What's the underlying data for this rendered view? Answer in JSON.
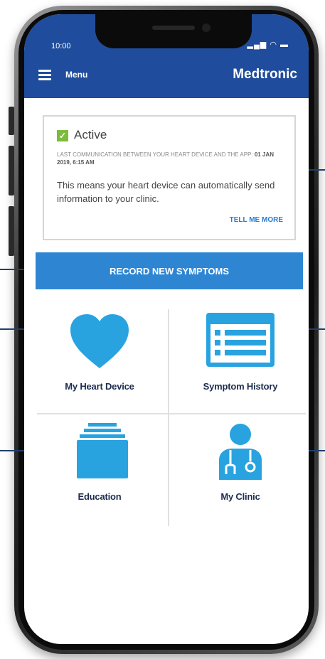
{
  "status_bar": {
    "time": "10:00"
  },
  "header": {
    "menu_label": "Menu",
    "brand": "Medtronic"
  },
  "status_card": {
    "title": "Active",
    "last_comm_text": "LAST COMMUNICATION BETWEEN YOUR HEART DEVICE AND THE APP:",
    "last_comm_date": "01 JAN 2019, 6:15 AM",
    "description": "This means your heart device can automatically send information to your clinic.",
    "link": "TELL ME MORE"
  },
  "record_button": {
    "label": "RECORD NEW SYMPTOMS"
  },
  "tiles": [
    {
      "label": "My Heart Device"
    },
    {
      "label": "Symptom History"
    },
    {
      "label": "Education"
    },
    {
      "label": "My Clinic"
    }
  ],
  "colors": {
    "header": "#1f4c9c",
    "accent": "#2e86d3",
    "icon": "#29a3e0",
    "active": "#7dbb3c"
  }
}
